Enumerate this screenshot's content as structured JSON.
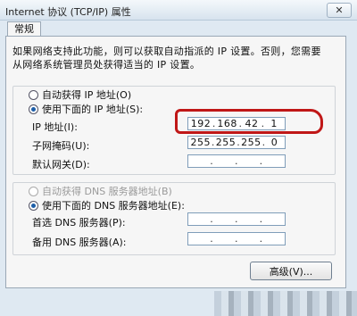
{
  "window": {
    "title": "Internet 协议 (TCP/IP) 属性",
    "close_symbol": "✕"
  },
  "tabs": [
    "常规"
  ],
  "intro": "如果网络支持此功能，则可以获取自动指派的 IP 设置。否则，您需要从网络系统管理员处获得适当的 IP 设置。",
  "ip": {
    "auto_label": "自动获得 IP 地址(O)",
    "manual_label": "使用下面的 IP 地址(S):",
    "address_label": "IP 地址(I):",
    "mask_label": "子网掩码(U):",
    "gateway_label": "默认网关(D):",
    "address": [
      "192",
      "168",
      "42",
      "1"
    ],
    "mask": [
      "255",
      "255",
      "255",
      "0"
    ],
    "gateway": [
      "",
      "",
      "",
      ""
    ]
  },
  "dns": {
    "auto_label": "自动获得 DNS 服务器地址(B)",
    "manual_label": "使用下面的 DNS 服务器地址(E):",
    "preferred_label": "首选 DNS 服务器(P):",
    "alternate_label": "备用 DNS 服务器(A):",
    "preferred": [
      "",
      "",
      "",
      ""
    ],
    "alternate": [
      "",
      "",
      "",
      ""
    ]
  },
  "buttons": {
    "advanced": "高级(V)..."
  },
  "colors": {
    "annotation": "#c01717"
  }
}
